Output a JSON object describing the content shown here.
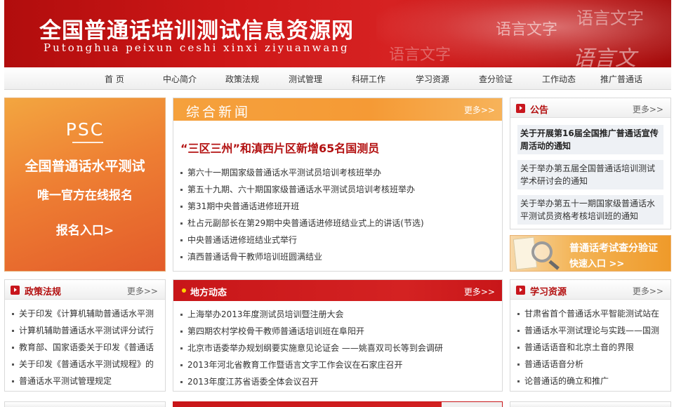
{
  "header": {
    "title": "全国普通话培训测试信息资源网",
    "pinyin": "Putonghua peixun ceshi xinxi ziyuanwang",
    "decorations": [
      "语言文字",
      "语言文字",
      "语言文字",
      "语言文"
    ]
  },
  "nav": {
    "items": [
      "首  页",
      "中心简介",
      "政策法规",
      "测试管理",
      "科研工作",
      "学习资源",
      "查分验证",
      "工作动态",
      "推广普通话"
    ]
  },
  "promo": {
    "logo": "PSC",
    "line1": "全国普通话水平测试",
    "line2": "唯一官方在线报名",
    "line3": "报名入口>"
  },
  "news": {
    "title": "综合新闻",
    "more": "更多>>",
    "headline": "“三区三州”和滇西片区新增65名国测员",
    "items": [
      "第六十一期国家级普通话水平测试员培训考核班举办",
      "第五十九期、六十期国家级普通话水平测试员培训考核班举办",
      "第31期中央普通话进修班开班",
      "杜占元副部长在第29期中央普通话进修班结业式上的讲话(节选)",
      "中央普通话进修班结业式举行",
      "滇西普通话骨干教师培训班圆满结业"
    ]
  },
  "notice": {
    "title": "公告",
    "more": "更多>>",
    "items": [
      {
        "text": "关于开展第16届全国推广普通话宣传周活动的通知",
        "bold": true
      },
      {
        "text": "关于举办第五届全国普通话培训测试学术研讨会的通知",
        "bold": false
      },
      {
        "text": "关于举办第五十一期国家级普通话水平测试员资格考核培训班的通知",
        "bold": false
      }
    ]
  },
  "query": {
    "line1": "普通话考试查分验证",
    "line2": "快速入口 >>"
  },
  "policy": {
    "title": "政策法规",
    "more": "更多>>",
    "items": [
      "关于印发《计算机辅助普通话水平测",
      "计算机辅助普通话水平测试评分试行",
      "教育部、国家语委关于印发《普通话",
      "关于印发《普通话水平测试规程》的",
      "普通话水平测试管理规定"
    ]
  },
  "local": {
    "title": "地方动态",
    "more": "更多>>",
    "items": [
      "上海举办2013年度测试员培训暨注册大会",
      "第四期农村学校骨干教师普通话培训班在阜阳开",
      "北京市语委举办规划纲要实施意见论证会 ——姚喜双司长等到会调研",
      "2013年河北省教育工作暨语言文字工作会议在石家庄召开",
      "2013年度江苏省语委全体会议召开"
    ]
  },
  "resources": {
    "title": "学习资源",
    "more": "更多>>",
    "items": [
      "甘肃省首个普通话水平智能测试站在",
      "普通话水平测试理论与实践——国测",
      "普通话语音和北京土音的界限",
      "普通话语音分析",
      "论普通话的确立和推广"
    ]
  }
}
